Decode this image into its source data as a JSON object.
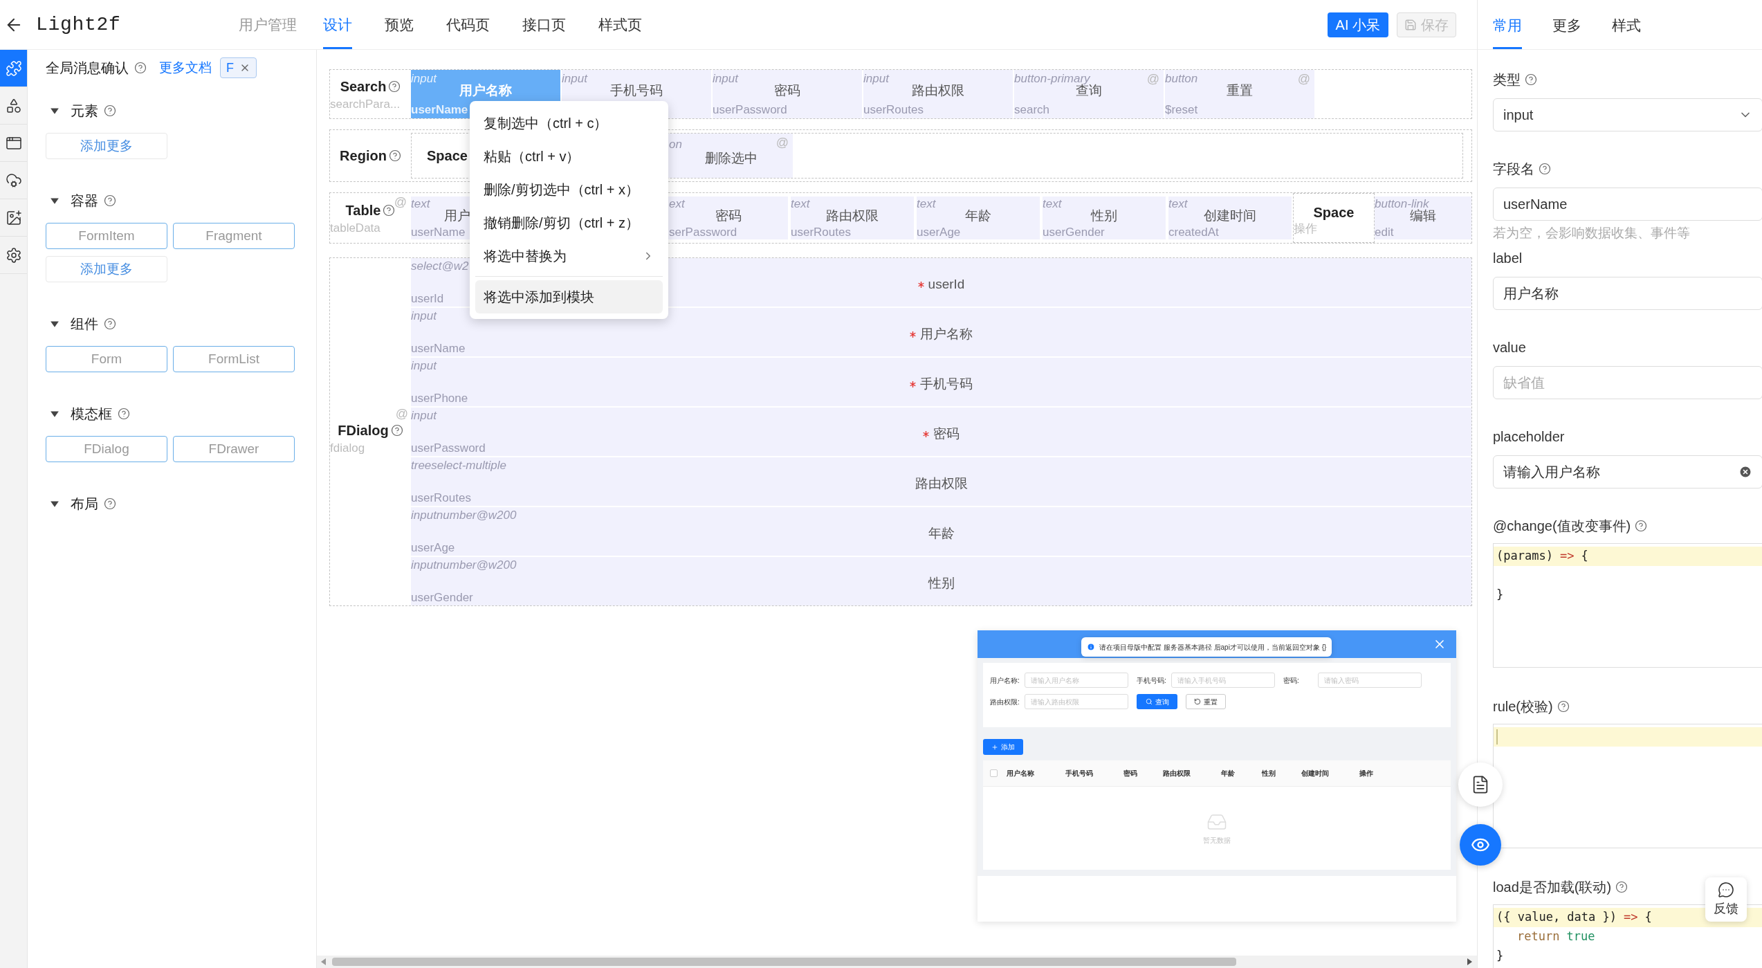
{
  "header": {
    "title": "Light2f",
    "page_name": "用户管理",
    "tabs": [
      {
        "label": "设计",
        "selected": true
      },
      {
        "label": "预览",
        "selected": false
      },
      {
        "label": "代码页",
        "selected": false
      },
      {
        "label": "接口页",
        "selected": false
      },
      {
        "label": "样式页",
        "selected": false
      }
    ],
    "ai_button": "AI 小呆",
    "save_button": {
      "label": "保存",
      "disabled": true
    }
  },
  "rail": [
    {
      "kind": "plugin",
      "selected": true
    },
    {
      "kind": "components",
      "selected": false
    },
    {
      "kind": "window",
      "selected": false
    },
    {
      "kind": "api",
      "selected": false
    },
    {
      "kind": "image",
      "selected": false
    },
    {
      "kind": "settings",
      "selected": false
    }
  ],
  "library": {
    "title": "全局消息确认",
    "docs_link": "更多文档",
    "tag": "F",
    "sections": [
      {
        "title": "元素",
        "expanded": true,
        "items": [
          {
            "label": "添加更多",
            "kind": "more"
          }
        ]
      },
      {
        "title": "容器",
        "expanded": true,
        "items": [
          {
            "label": "FormItem",
            "kind": "component"
          },
          {
            "label": "Fragment",
            "kind": "component"
          },
          {
            "label": "添加更多",
            "kind": "more"
          }
        ]
      },
      {
        "title": "组件",
        "expanded": true,
        "items": [
          {
            "label": "Form",
            "kind": "component"
          },
          {
            "label": "FormList",
            "kind": "component"
          }
        ]
      },
      {
        "title": "模态框",
        "expanded": true,
        "items": [
          {
            "label": "FDialog",
            "kind": "component"
          },
          {
            "label": "FDrawer",
            "kind": "component"
          }
        ]
      },
      {
        "title": "布局",
        "expanded": true
      }
    ]
  },
  "canvas": {
    "search": {
      "label": "Search",
      "field": "searchPara...",
      "cells": [
        {
          "type": "input",
          "label": "用户名称",
          "field": "userName",
          "selected": true
        },
        {
          "type": "input",
          "label": "手机号码",
          "selected": false
        },
        {
          "type": "input",
          "label": "密码",
          "field": "userPassword",
          "selected": false
        },
        {
          "type": "input",
          "label": "路由权限",
          "field": "userRoutes",
          "selected": false
        },
        {
          "type": "button-primary",
          "label": "查询",
          "field": "search",
          "mark": "@",
          "selected": false
        },
        {
          "type": "button",
          "label": "重置",
          "field": "$reset",
          "mark": "@",
          "selected": false
        }
      ]
    },
    "region": {
      "label": "Region",
      "inner_label": "Space",
      "cell": {
        "type": "on",
        "label": "删除选中",
        "mark": "@"
      }
    },
    "table": {
      "label": "Table",
      "field": "tableData",
      "mark": "@",
      "columns": [
        {
          "type": "text",
          "label": "用户",
          "field": "userName"
        },
        {
          "type": "ext",
          "label": "密码",
          "field": "serPassword"
        },
        {
          "type": "text",
          "label": "路由权限",
          "field": "userRoutes"
        },
        {
          "type": "text",
          "label": "年龄",
          "field": "userAge"
        },
        {
          "type": "text",
          "label": "性别",
          "field": "userGender"
        },
        {
          "type": "text",
          "label": "创建时间",
          "field": "createdAt"
        }
      ],
      "space": {
        "label": "Space",
        "field": "操作"
      },
      "action": {
        "type": "button-link",
        "label": "编辑",
        "field": "edit"
      }
    },
    "dialog": {
      "label": "FDialog",
      "field": "fdialog",
      "mark": "@",
      "rows": [
        {
          "type": "select@w2",
          "label": "userId",
          "field": "userId",
          "required": true
        },
        {
          "type": "input",
          "label": "用户名称",
          "field": "userName",
          "required": true
        },
        {
          "type": "input",
          "label": "手机号码",
          "field": "userPhone",
          "required": true
        },
        {
          "type": "input",
          "label": "密码",
          "field": "userPassword",
          "required": true
        },
        {
          "type": "treeselect-multiple",
          "label": "路由权限",
          "field": "userRoutes",
          "required": false
        },
        {
          "type": "inputnumber@w200",
          "label": "年龄",
          "field": "userAge",
          "required": false
        },
        {
          "type": "inputnumber@w200",
          "label": "性别",
          "field": "userGender",
          "required": false
        }
      ]
    }
  },
  "context_menu": {
    "items": [
      {
        "kind": "item",
        "label": "复制选中（ctrl + c）",
        "highlighted": false
      },
      {
        "kind": "item",
        "label": "粘贴（ctrl + v）",
        "highlighted": false
      },
      {
        "kind": "item",
        "label": "删除/剪切选中（ctrl + x）",
        "highlighted": false
      },
      {
        "kind": "item",
        "label": "撤销删除/剪切（ctrl + z）",
        "highlighted": false
      },
      {
        "kind": "submenu",
        "label": "将选中替换为",
        "highlighted": false
      },
      {
        "kind": "separator"
      },
      {
        "kind": "item",
        "label": "将选中添加到模块",
        "highlighted": true
      }
    ]
  },
  "preview": {
    "notice": "请在项目母版中配置 服务器基本路径 后api才可以使用，当前返回空对象 {}",
    "form": [
      {
        "label": "用户名称:",
        "placeholder": "请输入用户名称"
      },
      {
        "label": "手机号码:",
        "placeholder": "请输入手机号码"
      },
      {
        "label": "密码:",
        "placeholder": "请输入密码"
      },
      {
        "label": "路由权限:",
        "placeholder": "请输入路由权限"
      }
    ],
    "search_button": "查询",
    "reset_button": "重置",
    "add_button": "添加",
    "select_all_checked": false,
    "columns": [
      "用户名称",
      "手机号码",
      "密码",
      "路由权限",
      "年龄",
      "性别",
      "创建时间",
      "操作"
    ],
    "empty_text": "暂无数据"
  },
  "properties": {
    "tabs": [
      {
        "label": "常用",
        "selected": true
      },
      {
        "label": "更多",
        "selected": false
      },
      {
        "label": "样式",
        "selected": false
      }
    ],
    "fields": [
      {
        "kind": "select",
        "label": "类型",
        "help": true,
        "value": "input"
      },
      {
        "kind": "input",
        "label": "字段名",
        "help": true,
        "value": "userName",
        "hint": "若为空，会影响数据收集、事件等",
        "clearable": false
      },
      {
        "kind": "input",
        "label": "label",
        "help": false,
        "value": "用户名称",
        "clearable": false
      },
      {
        "kind": "input",
        "label": "value",
        "help": false,
        "placeholder": "缺省值",
        "clearable": false
      },
      {
        "kind": "input",
        "label": "placeholder",
        "help": false,
        "value": "请输入用户名称",
        "clearable": true
      },
      {
        "kind": "code",
        "label": "@change(值改变事件)",
        "help": true,
        "lines": [
          {
            "active": true,
            "tokens": [
              {
                "t": "(params)",
                "color": "#222222"
              },
              {
                "t": "=>",
                "color": "#c0392b"
              },
              {
                "t": "{",
                "color": "#222222"
              }
            ]
          },
          {
            "active": false,
            "blank_before": true,
            "tokens": [
              {
                "t": "}",
                "color": "#222222"
              }
            ]
          }
        ]
      },
      {
        "kind": "code",
        "label": "rule(校验)",
        "help": true,
        "lines": [
          {
            "active": true
          }
        ]
      },
      {
        "kind": "code",
        "label": "load是否加载(联动)",
        "help": true,
        "lines": [
          {
            "active": true,
            "tokens": [
              {
                "t": "({ value, data })",
                "color": "#222222"
              },
              {
                "t": "=>",
                "color": "#c0392b"
              },
              {
                "t": "{",
                "color": "#222222"
              }
            ]
          },
          {
            "active": false,
            "indented": true,
            "tokens": [
              {
                "t": "return",
                "color": "#9a6e3a"
              },
              {
                "t": "true",
                "color": "#219161"
              }
            ]
          },
          {
            "active": false,
            "tokens": [
              {
                "t": "}",
                "color": "#222222"
              }
            ]
          }
        ]
      }
    ]
  },
  "feedback_button": "反馈"
}
